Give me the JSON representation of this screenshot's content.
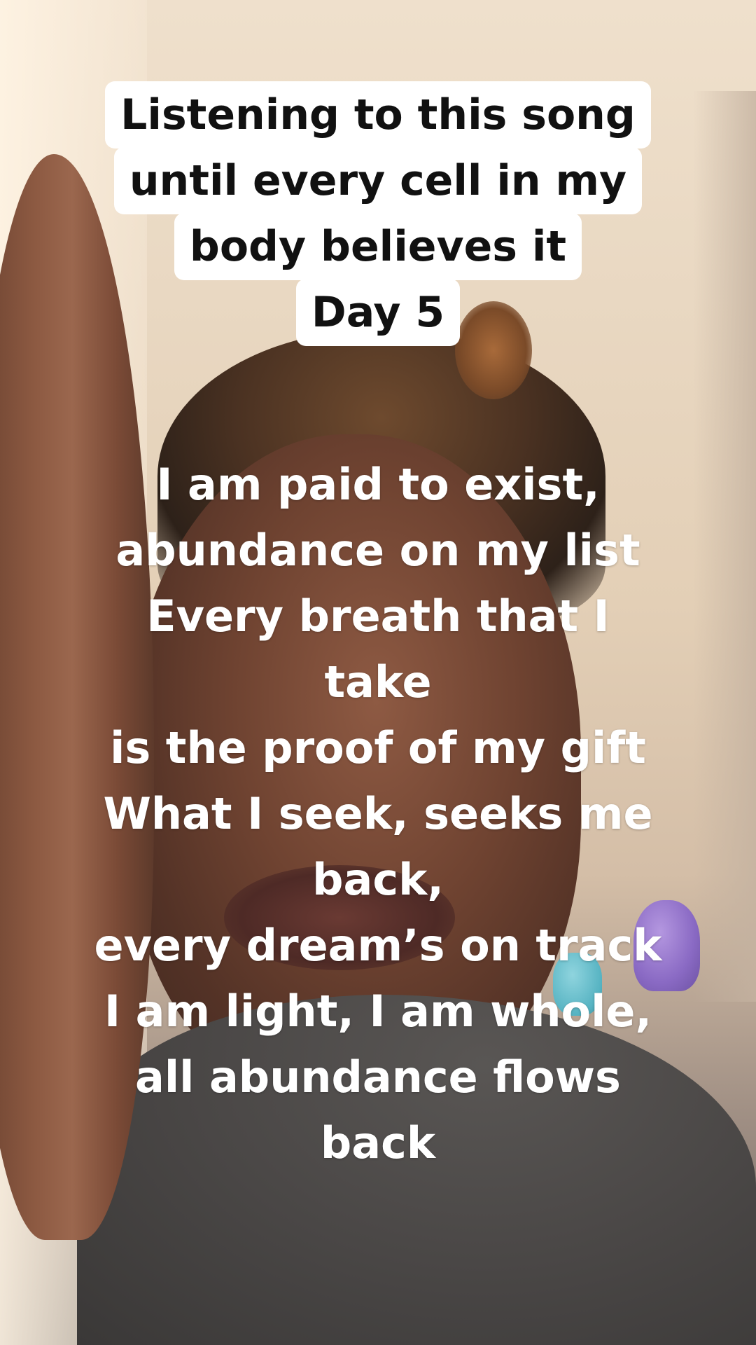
{
  "overlay": {
    "title_lines": [
      "Listening to this song",
      "until every cell in my",
      "body believes it",
      "Day 5"
    ],
    "lyrics_lines": [
      "I am paid to exist,",
      "abundance on my list",
      "Every breath that I",
      "take",
      "is the proof of my gift",
      "What I seek, seeks me",
      "back,",
      "every dream’s on track",
      "I am light, I am whole,",
      "all abundance flows",
      "back"
    ]
  }
}
